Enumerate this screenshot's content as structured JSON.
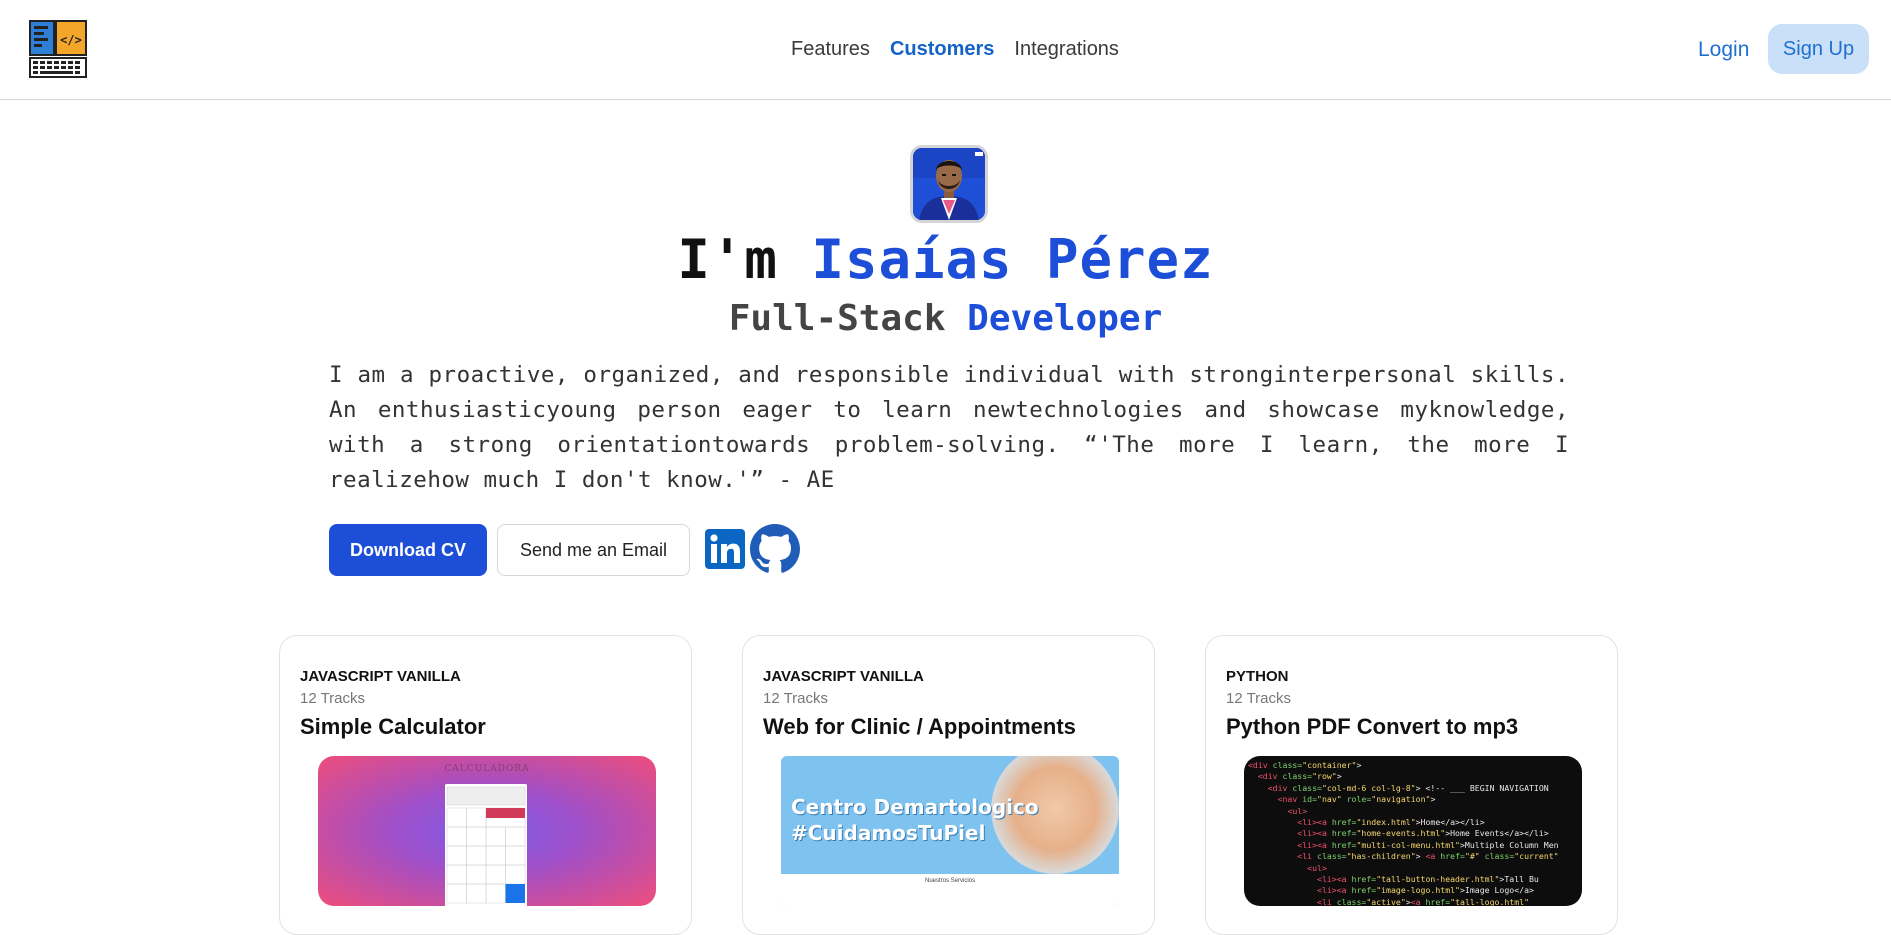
{
  "nav": {
    "links": [
      "Features",
      "Customers",
      "Integrations"
    ],
    "active_index": 1,
    "login": "Login",
    "signup": "Sign Up"
  },
  "hero": {
    "title_prefix": "I'm ",
    "title_name": "Isaías Pérez",
    "subtitle_prefix": "Full-Stack ",
    "subtitle_highlight": "Developer",
    "bio": "I am a proactive, organized, and responsible individual with stronginterpersonal skills. An enthusiasticyoung person eager to learn newtechnologies and showcase myknowledge, with a strong orientationtowards problem-solving. “'The more I learn, the more I realizehow much I don't know.'” - AE",
    "download_cv": "Download CV",
    "send_email": "Send me an Email"
  },
  "icons": {
    "logo": "code-laptop-logo",
    "linkedin": "linkedin-icon",
    "github": "github-icon"
  },
  "colors": {
    "accent": "#1d4ed8",
    "nav_active": "#1464c8",
    "signup_bg": "#c9e0f8"
  },
  "cards": [
    {
      "category": "JAVASCRIPT VANILLA",
      "tracks": "12 Tracks",
      "title": "Simple Calculator",
      "thumb_text": "CALCULADORA"
    },
    {
      "category": "JAVASCRIPT VANILLA",
      "tracks": "12 Tracks",
      "title": "Web for Clinic / Appointments",
      "thumb_line1": "Centro Demartologico",
      "thumb_line2": "#CuidamosTuPiel",
      "thumb_services": "Nuestros Servicios"
    },
    {
      "category": "PYTHON",
      "tracks": "12 Tracks",
      "title": "Python PDF Convert to mp3"
    }
  ]
}
